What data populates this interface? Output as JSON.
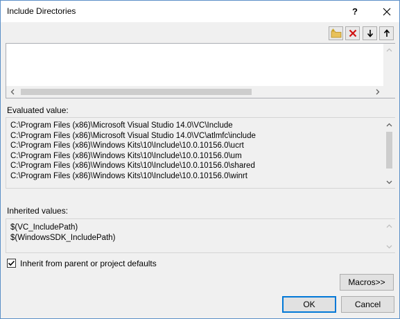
{
  "window": {
    "title": "Include Directories",
    "help_label": "?",
    "close_label": "✕"
  },
  "toolbar": {
    "icons": [
      "new-folder-icon",
      "delete-icon",
      "move-down-icon",
      "move-up-icon"
    ]
  },
  "edit_list": {
    "lines": []
  },
  "evaluated": {
    "label": "Evaluated value:",
    "lines": [
      "C:\\Program Files (x86)\\Microsoft Visual Studio 14.0\\VC\\Include",
      "C:\\Program Files (x86)\\Microsoft Visual Studio 14.0\\VC\\atlmfc\\include",
      "C:\\Program Files (x86)\\Windows Kits\\10\\Include\\10.0.10156.0\\ucrt",
      "C:\\Program Files (x86)\\Windows Kits\\10\\Include\\10.0.10156.0\\um",
      "C:\\Program Files (x86)\\Windows Kits\\10\\Include\\10.0.10156.0\\shared",
      "C:\\Program Files (x86)\\Windows Kits\\10\\Include\\10.0.10156.0\\winrt"
    ]
  },
  "inherited": {
    "label": "Inherited values:",
    "lines": [
      "$(VC_IncludePath)",
      "$(WindowsSDK_IncludePath)"
    ]
  },
  "inherit_checkbox": {
    "label": "Inherit from parent or project defaults",
    "checked": true
  },
  "buttons": {
    "macros": "Macros>>",
    "ok": "OK",
    "cancel": "Cancel"
  },
  "colors": {
    "accent": "#0078d7",
    "border": "#5b8fc7",
    "delete_red": "#d01010"
  }
}
